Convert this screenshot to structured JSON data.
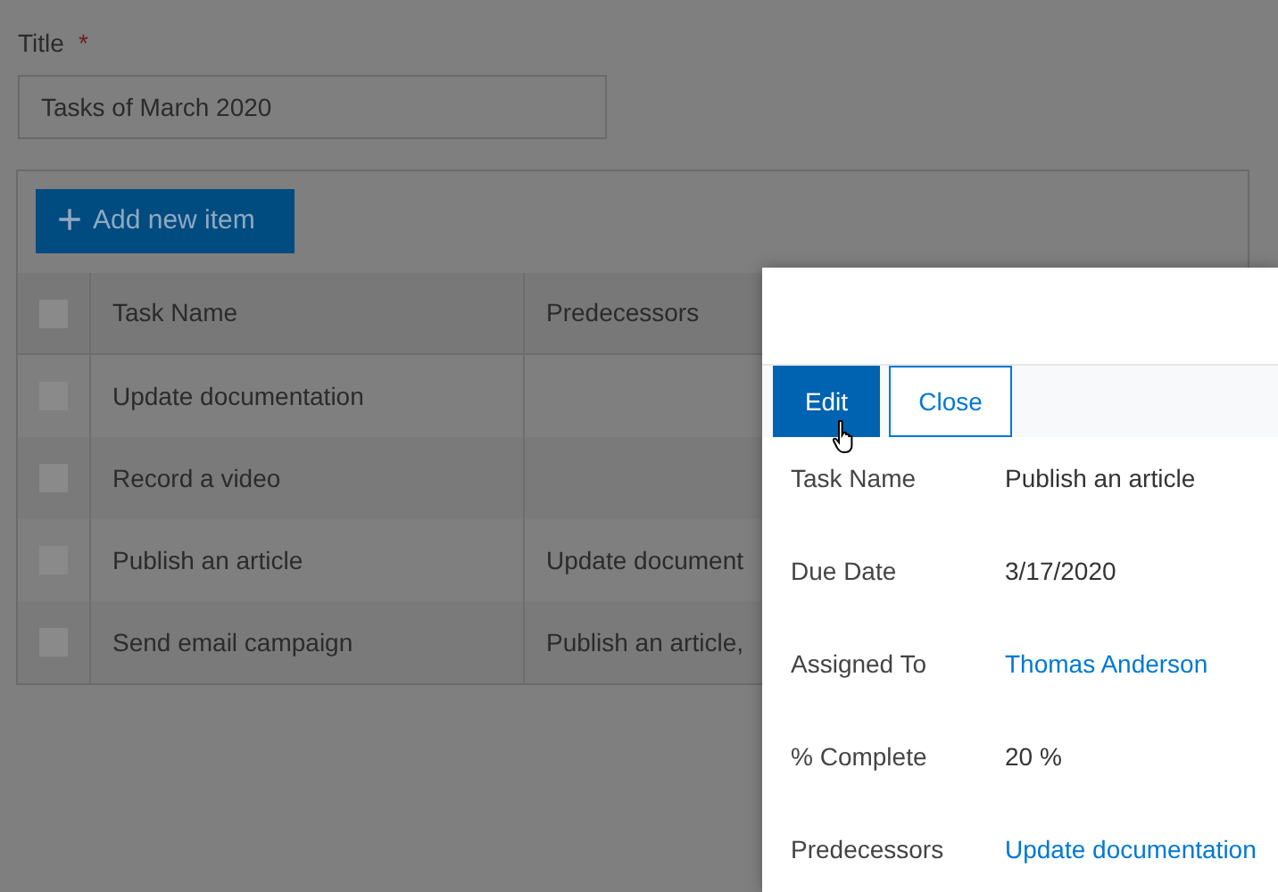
{
  "title_field": {
    "label": "Title",
    "required_mark": "*",
    "value": "Tasks of March 2020"
  },
  "add_button": {
    "icon": "+",
    "label": "Add new item"
  },
  "table": {
    "select_all_checked": false,
    "columns": [
      "Task Name",
      "Predecessors"
    ],
    "rows": [
      {
        "checked": false,
        "cells": [
          "Update documentation",
          ""
        ]
      },
      {
        "checked": false,
        "cells": [
          "Record a video",
          ""
        ]
      },
      {
        "checked": false,
        "cells": [
          "Publish an article",
          "Update document"
        ]
      },
      {
        "checked": false,
        "cells": [
          "Send email campaign",
          "Publish an article,"
        ]
      }
    ]
  },
  "panel": {
    "buttons": [
      {
        "label": "Edit",
        "kind": "primary"
      },
      {
        "label": "Close",
        "kind": "secondary"
      }
    ],
    "fields": [
      {
        "label": "Task Name",
        "value": "Publish an article",
        "kind": "text"
      },
      {
        "label": "Due Date",
        "value": "3/17/2020",
        "kind": "text"
      },
      {
        "label": "Assigned To",
        "value": "Thomas Anderson",
        "kind": "link"
      },
      {
        "label": "% Complete",
        "value": "20 %",
        "kind": "text"
      },
      {
        "label": "Predecessors",
        "value": "Update documentation",
        "kind": "link"
      }
    ]
  }
}
